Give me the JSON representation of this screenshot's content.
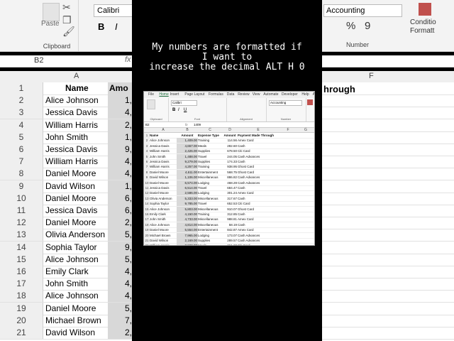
{
  "caption": "My numbers are formatted if\nI want to\nincrease the decimal ALT H 0",
  "bg": {
    "ribbon": {
      "paste": "Paste",
      "clipboard": "Clipboard",
      "font": "Calibri",
      "number_format": "Accounting",
      "number": "Number",
      "conditional": "Conditio\nFormatt",
      "percent": "%",
      "comma": "9",
      "bold": "B",
      "italic": "I"
    },
    "name_box": "B2",
    "fx": "fx",
    "cols": [
      "A",
      "F"
    ],
    "header_name": "Name",
    "header_amt": "Amo",
    "header_through": "hrough",
    "rows": [
      {
        "n": "1",
        "name": "Name"
      },
      {
        "n": "2",
        "name": "Alice Johnson",
        "amt": "1,"
      },
      {
        "n": "3",
        "name": "Jessica Davis",
        "amt": "4,"
      },
      {
        "n": "4",
        "name": "William Harris",
        "amt": "2,"
      },
      {
        "n": "5",
        "name": "John Smith",
        "amt": "1,"
      },
      {
        "n": "6",
        "name": "Jessica Davis",
        "amt": "9,"
      },
      {
        "n": "7",
        "name": "William Harris",
        "amt": "4,"
      },
      {
        "n": "8",
        "name": "Daniel Moore",
        "amt": "4,"
      },
      {
        "n": "9",
        "name": "David Wilson",
        "amt": "1,"
      },
      {
        "n": "10",
        "name": "Daniel Moore",
        "amt": "6,"
      },
      {
        "n": "11",
        "name": "Jessica Davis",
        "amt": "6,"
      },
      {
        "n": "12",
        "name": "Daniel Moore",
        "amt": "2,"
      },
      {
        "n": "13",
        "name": "Olivia Anderson",
        "amt": "5,"
      },
      {
        "n": "14",
        "name": "Sophia Taylor",
        "amt": "9,"
      },
      {
        "n": "15",
        "name": "Alice Johnson",
        "amt": "5,"
      },
      {
        "n": "16",
        "name": "Emily Clark",
        "amt": "4,"
      },
      {
        "n": "17",
        "name": "John Smith",
        "amt": "4,"
      },
      {
        "n": "18",
        "name": "Alice Johnson",
        "amt": "4,"
      },
      {
        "n": "19",
        "name": "Daniel Moore",
        "amt": "5,"
      },
      {
        "n": "20",
        "name": "Michael Brown",
        "amt": "7,"
      },
      {
        "n": "21",
        "name": "David Wilson",
        "amt": "2,"
      }
    ]
  },
  "inner": {
    "tabs": [
      "File",
      "Home",
      "Insert",
      "Page Layout",
      "Formulas",
      "Data",
      "Review",
      "View",
      "Automate",
      "Developer",
      "Help",
      "Acrobat"
    ],
    "ribbon_groups": [
      "Clipboard",
      "Font",
      "Alignment",
      "Number"
    ],
    "font": "Calibri",
    "number_format": "Accounting",
    "name_box": "B2",
    "formula_value": "1409",
    "col_letters": [
      "A",
      "B",
      "C",
      "D",
      "E",
      "F",
      "G"
    ],
    "headers": [
      "Name",
      "Amount",
      "Expense Type",
      "Amount",
      "Payment Made Through"
    ],
    "rows": [
      [
        "2",
        "Alice Johnson",
        "1,409.00",
        "Training",
        "114.56",
        "Amex Card"
      ],
      [
        "3",
        "Jessica Davis",
        "4,657.00",
        "Meals",
        "282.60",
        "Cash"
      ],
      [
        "4",
        "William Harris",
        "2,426.00",
        "Supplies",
        "678.50",
        "Citi Card"
      ],
      [
        "5",
        "John Smith",
        "1,488.00",
        "Travel",
        "244.05",
        "Cash Advances"
      ],
      [
        "6",
        "Jessica Davis",
        "9,279.00",
        "Supplies",
        "174.33",
        "Cash"
      ],
      [
        "7",
        "William Harris",
        "4,257.00",
        "Training",
        "938.95",
        "Ghost Card"
      ],
      [
        "8",
        "Daniel Moore",
        "4,611.00",
        "Entertainment",
        "568.75",
        "Ghost Card"
      ],
      [
        "9",
        "David Wilson",
        "1,106.00",
        "Miscellaneous",
        "886.82",
        "Cash Advances"
      ],
      [
        "10",
        "Daniel Moore",
        "6,574.00",
        "Lodging",
        "468.28",
        "Cash Advances"
      ],
      [
        "11",
        "Jessica Davis",
        "6,514.00",
        "Travel",
        "684.47",
        "Cash"
      ],
      [
        "12",
        "Daniel Moore",
        "2,586.00",
        "Lodging",
        "301.24",
        "Amex Card"
      ],
      [
        "13",
        "Olivia Anderson",
        "5,333.00",
        "Miscellaneous",
        "317.67",
        "Cash"
      ],
      [
        "14",
        "Sophia Taylor",
        "9,785.00",
        "Travel",
        "652.53",
        "Citi Card"
      ],
      [
        "15",
        "Alice Johnson",
        "5,803.00",
        "Miscellaneous",
        "910.07",
        "Ghost Card"
      ],
      [
        "16",
        "Emily Clark",
        "4,150.00",
        "Training",
        "312.85",
        "Cash"
      ],
      [
        "17",
        "John Smith",
        "4,733.00",
        "Miscellaneous",
        "988.81",
        "Amex Card"
      ],
      [
        "18",
        "Alice Johnson",
        "4,814.00",
        "Miscellaneous",
        "58.19",
        "Cash"
      ],
      [
        "19",
        "Daniel Moore",
        "5,554.00",
        "Entertainment",
        "842.87",
        "Amex Card"
      ],
      [
        "20",
        "Michael Brown",
        "7,965.00",
        "Lodging",
        "173.07",
        "Cash Advances"
      ],
      [
        "21",
        "David Wilson",
        "2,169.00",
        "Supplies",
        "289.57",
        "Cash Advances"
      ],
      [
        "22",
        "William Harris",
        "3,920.00",
        "Meals",
        "361.28",
        "Citi Card"
      ]
    ]
  }
}
